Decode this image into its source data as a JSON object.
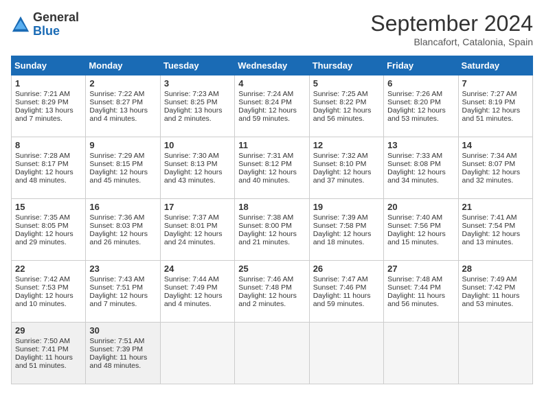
{
  "header": {
    "logo_general": "General",
    "logo_blue": "Blue",
    "month_title": "September 2024",
    "location": "Blancafort, Catalonia, Spain"
  },
  "days_of_week": [
    "Sunday",
    "Monday",
    "Tuesday",
    "Wednesday",
    "Thursday",
    "Friday",
    "Saturday"
  ],
  "weeks": [
    [
      {
        "day": "1",
        "sunrise": "Sunrise: 7:21 AM",
        "sunset": "Sunset: 8:29 PM",
        "daylight": "Daylight: 13 hours and 7 minutes."
      },
      {
        "day": "2",
        "sunrise": "Sunrise: 7:22 AM",
        "sunset": "Sunset: 8:27 PM",
        "daylight": "Daylight: 13 hours and 4 minutes."
      },
      {
        "day": "3",
        "sunrise": "Sunrise: 7:23 AM",
        "sunset": "Sunset: 8:25 PM",
        "daylight": "Daylight: 13 hours and 2 minutes."
      },
      {
        "day": "4",
        "sunrise": "Sunrise: 7:24 AM",
        "sunset": "Sunset: 8:24 PM",
        "daylight": "Daylight: 12 hours and 59 minutes."
      },
      {
        "day": "5",
        "sunrise": "Sunrise: 7:25 AM",
        "sunset": "Sunset: 8:22 PM",
        "daylight": "Daylight: 12 hours and 56 minutes."
      },
      {
        "day": "6",
        "sunrise": "Sunrise: 7:26 AM",
        "sunset": "Sunset: 8:20 PM",
        "daylight": "Daylight: 12 hours and 53 minutes."
      },
      {
        "day": "7",
        "sunrise": "Sunrise: 7:27 AM",
        "sunset": "Sunset: 8:19 PM",
        "daylight": "Daylight: 12 hours and 51 minutes."
      }
    ],
    [
      {
        "day": "8",
        "sunrise": "Sunrise: 7:28 AM",
        "sunset": "Sunset: 8:17 PM",
        "daylight": "Daylight: 12 hours and 48 minutes."
      },
      {
        "day": "9",
        "sunrise": "Sunrise: 7:29 AM",
        "sunset": "Sunset: 8:15 PM",
        "daylight": "Daylight: 12 hours and 45 minutes."
      },
      {
        "day": "10",
        "sunrise": "Sunrise: 7:30 AM",
        "sunset": "Sunset: 8:13 PM",
        "daylight": "Daylight: 12 hours and 43 minutes."
      },
      {
        "day": "11",
        "sunrise": "Sunrise: 7:31 AM",
        "sunset": "Sunset: 8:12 PM",
        "daylight": "Daylight: 12 hours and 40 minutes."
      },
      {
        "day": "12",
        "sunrise": "Sunrise: 7:32 AM",
        "sunset": "Sunset: 8:10 PM",
        "daylight": "Daylight: 12 hours and 37 minutes."
      },
      {
        "day": "13",
        "sunrise": "Sunrise: 7:33 AM",
        "sunset": "Sunset: 8:08 PM",
        "daylight": "Daylight: 12 hours and 34 minutes."
      },
      {
        "day": "14",
        "sunrise": "Sunrise: 7:34 AM",
        "sunset": "Sunset: 8:07 PM",
        "daylight": "Daylight: 12 hours and 32 minutes."
      }
    ],
    [
      {
        "day": "15",
        "sunrise": "Sunrise: 7:35 AM",
        "sunset": "Sunset: 8:05 PM",
        "daylight": "Daylight: 12 hours and 29 minutes."
      },
      {
        "day": "16",
        "sunrise": "Sunrise: 7:36 AM",
        "sunset": "Sunset: 8:03 PM",
        "daylight": "Daylight: 12 hours and 26 minutes."
      },
      {
        "day": "17",
        "sunrise": "Sunrise: 7:37 AM",
        "sunset": "Sunset: 8:01 PM",
        "daylight": "Daylight: 12 hours and 24 minutes."
      },
      {
        "day": "18",
        "sunrise": "Sunrise: 7:38 AM",
        "sunset": "Sunset: 8:00 PM",
        "daylight": "Daylight: 12 hours and 21 minutes."
      },
      {
        "day": "19",
        "sunrise": "Sunrise: 7:39 AM",
        "sunset": "Sunset: 7:58 PM",
        "daylight": "Daylight: 12 hours and 18 minutes."
      },
      {
        "day": "20",
        "sunrise": "Sunrise: 7:40 AM",
        "sunset": "Sunset: 7:56 PM",
        "daylight": "Daylight: 12 hours and 15 minutes."
      },
      {
        "day": "21",
        "sunrise": "Sunrise: 7:41 AM",
        "sunset": "Sunset: 7:54 PM",
        "daylight": "Daylight: 12 hours and 13 minutes."
      }
    ],
    [
      {
        "day": "22",
        "sunrise": "Sunrise: 7:42 AM",
        "sunset": "Sunset: 7:53 PM",
        "daylight": "Daylight: 12 hours and 10 minutes."
      },
      {
        "day": "23",
        "sunrise": "Sunrise: 7:43 AM",
        "sunset": "Sunset: 7:51 PM",
        "daylight": "Daylight: 12 hours and 7 minutes."
      },
      {
        "day": "24",
        "sunrise": "Sunrise: 7:44 AM",
        "sunset": "Sunset: 7:49 PM",
        "daylight": "Daylight: 12 hours and 4 minutes."
      },
      {
        "day": "25",
        "sunrise": "Sunrise: 7:46 AM",
        "sunset": "Sunset: 7:48 PM",
        "daylight": "Daylight: 12 hours and 2 minutes."
      },
      {
        "day": "26",
        "sunrise": "Sunrise: 7:47 AM",
        "sunset": "Sunset: 7:46 PM",
        "daylight": "Daylight: 11 hours and 59 minutes."
      },
      {
        "day": "27",
        "sunrise": "Sunrise: 7:48 AM",
        "sunset": "Sunset: 7:44 PM",
        "daylight": "Daylight: 11 hours and 56 minutes."
      },
      {
        "day": "28",
        "sunrise": "Sunrise: 7:49 AM",
        "sunset": "Sunset: 7:42 PM",
        "daylight": "Daylight: 11 hours and 53 minutes."
      }
    ],
    [
      {
        "day": "29",
        "sunrise": "Sunrise: 7:50 AM",
        "sunset": "Sunset: 7:41 PM",
        "daylight": "Daylight: 11 hours and 51 minutes."
      },
      {
        "day": "30",
        "sunrise": "Sunrise: 7:51 AM",
        "sunset": "Sunset: 7:39 PM",
        "daylight": "Daylight: 11 hours and 48 minutes."
      },
      {
        "day": "",
        "sunrise": "",
        "sunset": "",
        "daylight": ""
      },
      {
        "day": "",
        "sunrise": "",
        "sunset": "",
        "daylight": ""
      },
      {
        "day": "",
        "sunrise": "",
        "sunset": "",
        "daylight": ""
      },
      {
        "day": "",
        "sunrise": "",
        "sunset": "",
        "daylight": ""
      },
      {
        "day": "",
        "sunrise": "",
        "sunset": "",
        "daylight": ""
      }
    ]
  ]
}
